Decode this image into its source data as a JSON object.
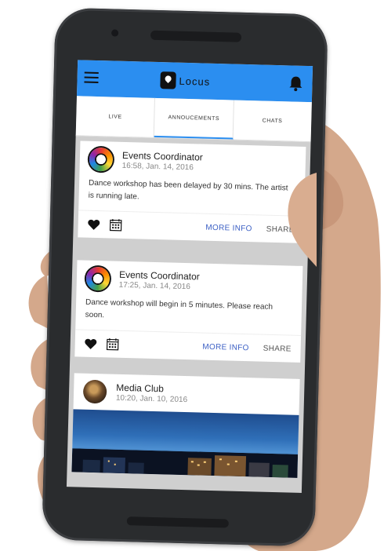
{
  "app": {
    "name": "Locus"
  },
  "tabs": [
    {
      "label": "LIVE"
    },
    {
      "label": "ANNOUCEMENTS"
    },
    {
      "label": "CHATS"
    }
  ],
  "posts": [
    {
      "author": "Events Coordinator",
      "timestamp": "16:58, Jan. 14, 2016",
      "message": "Dance workshop has been delayed by 30 mins. The artist is running late.",
      "more_label": "MORE INFO",
      "share_label": "SHARE"
    },
    {
      "author": "Events Coordinator",
      "timestamp": "17:25, Jan. 14, 2016",
      "message": "Dance workshop will begin in 5 minutes. Please reach soon.",
      "more_label": "MORE INFO",
      "share_label": "SHARE"
    },
    {
      "author": "Media Club",
      "timestamp": "10:20, Jan. 10, 2016"
    }
  ],
  "colors": {
    "appbar": "#2b8ef0",
    "link": "#3b5fc4"
  },
  "icons": [
    "menu-icon",
    "location-pin-icon",
    "bell-icon",
    "heart-icon",
    "calendar-icon"
  ]
}
